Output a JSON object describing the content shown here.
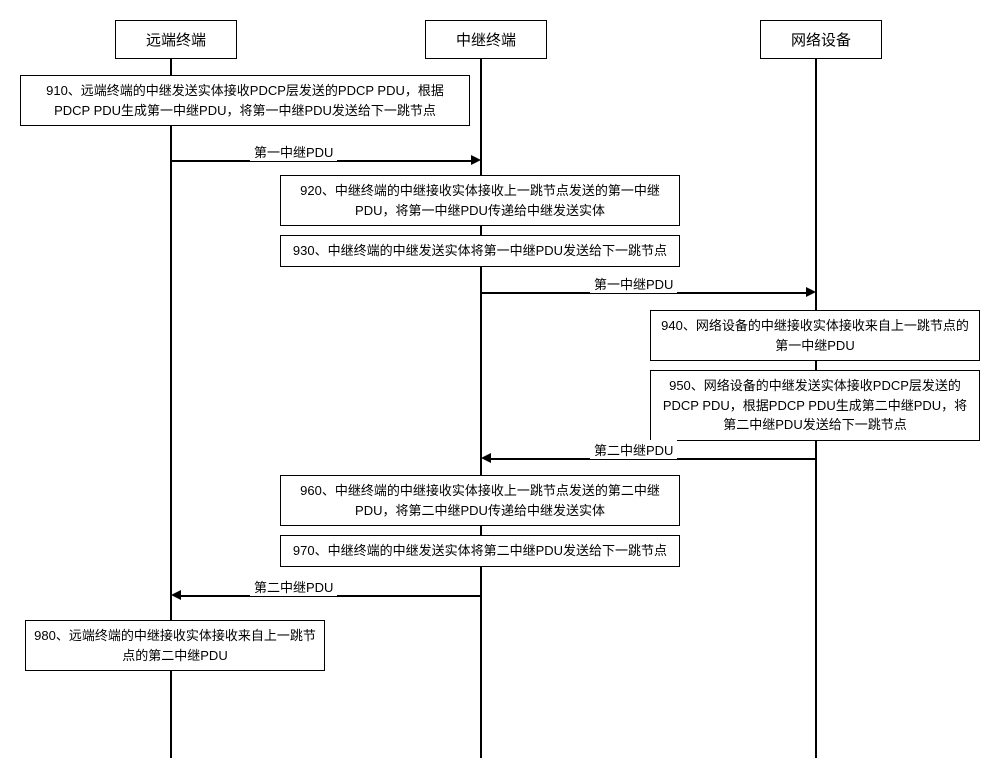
{
  "participants": {
    "p1": "远端终端",
    "p2": "中继终端",
    "p3": "网络设备"
  },
  "steps": {
    "s910": "910、远端终端的中继发送实体接收PDCP层发送的PDCP PDU，根据PDCP PDU生成第一中继PDU，将第一中继PDU发送给下一跳节点",
    "s920": "920、中继终端的中继接收实体接收上一跳节点发送的第一中继PDU，将第一中继PDU传递给中继发送实体",
    "s930": "930、中继终端的中继发送实体将第一中继PDU发送给下一跳节点",
    "s940": "940、网络设备的中继接收实体接收来自上一跳节点的第一中继PDU",
    "s950": "950、网络设备的中继发送实体接收PDCP层发送的PDCP PDU，根据PDCP PDU生成第二中继PDU，将第二中继PDU发送给下一跳节点",
    "s960": "960、中继终端的中继接收实体接收上一跳节点发送的第二中继PDU，将第二中继PDU传递给中继发送实体",
    "s970": "970、中继终端的中继发送实体将第二中继PDU发送给下一跳节点",
    "s980": "980、远端终端的中继接收实体接收来自上一跳节点的第二中继PDU"
  },
  "arrows": {
    "a1": "第一中继PDU",
    "a2": "第一中继PDU",
    "a3": "第二中继PDU",
    "a4": "第二中继PDU"
  }
}
